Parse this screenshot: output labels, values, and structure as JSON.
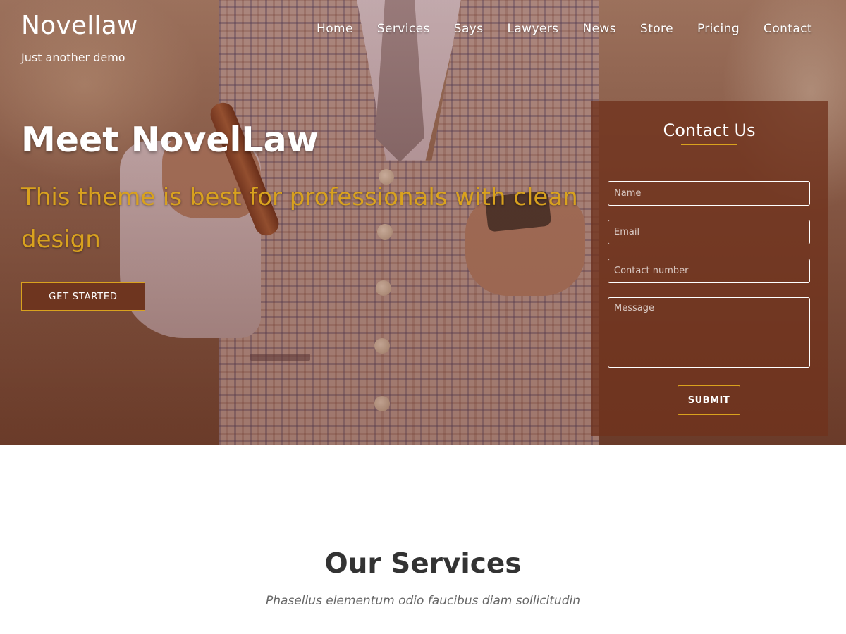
{
  "site": {
    "title": "Novellaw",
    "tagline": "Just another demo"
  },
  "nav": {
    "items": [
      "Home",
      "Services",
      "Says",
      "Lawyers",
      "News",
      "Store",
      "Pricing",
      "Contact"
    ]
  },
  "hero": {
    "title": "Meet NovelLaw",
    "subtitle": "This theme is best for professionals with clean design",
    "cta_label": "GET STARTED"
  },
  "contact": {
    "title": "Contact Us",
    "name_placeholder": "Name",
    "email_placeholder": "Email",
    "phone_placeholder": "Contact number",
    "message_placeholder": "Message",
    "submit_label": "SUBMIT"
  },
  "services": {
    "title": "Our Services",
    "subtitle": "Phasellus elementum odio faucibus diam sollicitudin"
  },
  "colors": {
    "accent": "#d9a21e",
    "brown": "#6e351f",
    "panel": "#70321c"
  }
}
